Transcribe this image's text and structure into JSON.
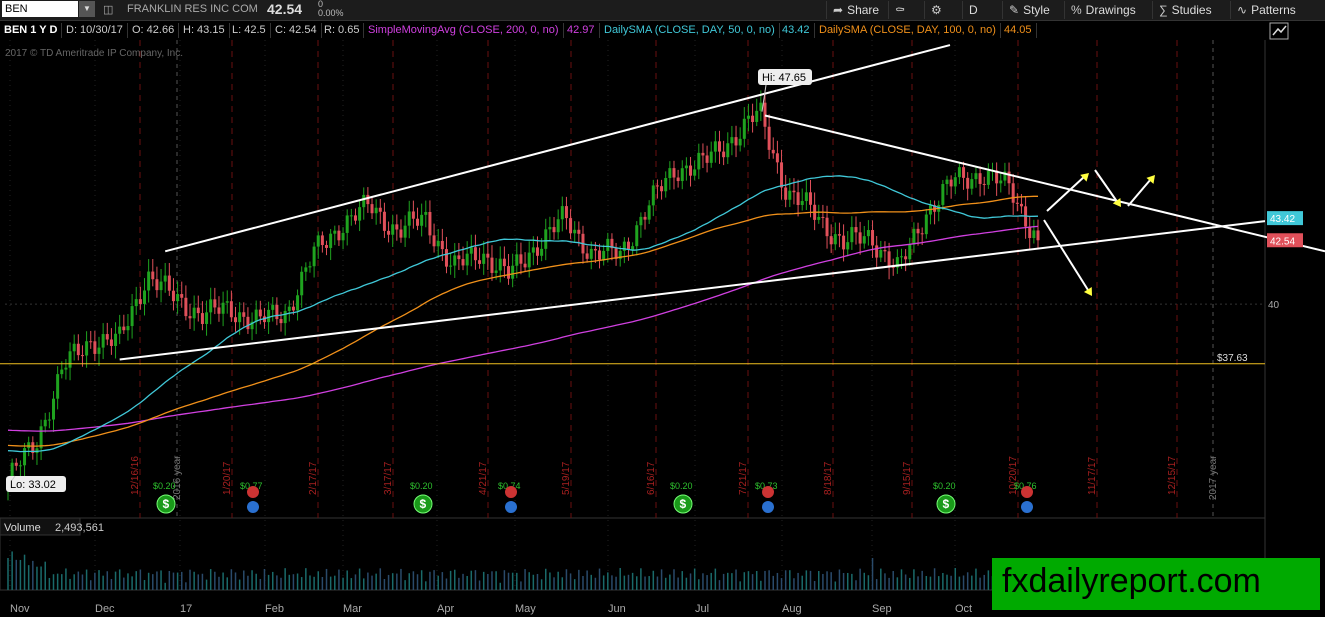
{
  "toolbar": {
    "symbol": "BEN",
    "company": "FRANKLIN RES INC COM",
    "last": "42.54",
    "change": "0",
    "change_pct": "0.00%",
    "share_label": "Share",
    "timeframe": "D",
    "style_label": "Style",
    "drawings_label": "Drawings",
    "studies_label": "Studies",
    "patterns_label": "Patterns"
  },
  "info": {
    "title": "BEN 1 Y D",
    "date": "D: 10/30/17",
    "open": "O: 42.66",
    "high": "H: 43.15",
    "low": "L: 42.5",
    "close": "C: 42.54",
    "range": "R: 0.65",
    "sma200_label": "SimpleMovingAvg (CLOSE, 200, 0, no)",
    "sma200_val": "42.97",
    "sma50_label": "DailySMA (CLOSE, DAY, 50, 0, no)",
    "sma50_val": "43.42",
    "sma100_label": "DailySMA (CLOSE, DAY, 100, 0, no)",
    "sma100_val": "44.05",
    "copyright": "2017 © TD Ameritrade IP Company, Inc."
  },
  "volume": {
    "label": "Volume",
    "value": "2,493,561"
  },
  "watermark": "fxdailyreport.com",
  "colors": {
    "up": "#1fa31f",
    "down": "#e0505a",
    "sma200": "#d040e0",
    "sma50": "#40c8d8",
    "sma100": "#f0901a",
    "support": "#f0c020",
    "trend": "#ffffff",
    "arrow": "#ffff40"
  },
  "chart_data": {
    "type": "candlestick",
    "symbol": "BEN",
    "ylim": [
      31.5,
      50.5
    ],
    "y_ticks": [
      40
    ],
    "x_labels": [
      "Nov",
      "Dec",
      "17",
      "Feb",
      "Mar",
      "Apr",
      "May",
      "Jun",
      "Jul",
      "Aug",
      "Sep",
      "Oct"
    ],
    "date_markers": [
      "12/16/16",
      "1/20/17",
      "2/17/17",
      "3/17/17",
      "4/21/17",
      "5/19/17",
      "6/16/17",
      "7/21/17",
      "8/18/17",
      "9/15/17",
      "10/20/17",
      "11/17/17",
      "12/15/17"
    ],
    "year_markers": [
      "2016 year",
      "2017 year"
    ],
    "price_labels": [
      {
        "label": "43.42",
        "value": 43.42,
        "color": "#40c8d8"
      },
      {
        "label": "42.54",
        "value": 42.54,
        "color": "#e0505a"
      },
      {
        "label": "$37.63",
        "value": 37.63,
        "color": "#f0c020"
      }
    ],
    "annotations": [
      {
        "text": "Hi: 47.65",
        "value": 47.65
      },
      {
        "text": "Lo: 33.02",
        "value": 33.02
      }
    ],
    "dividends": [
      {
        "label": "$0.20",
        "type": "dividend",
        "date": "Dec"
      },
      {
        "label": "$0.77",
        "type": "earnings",
        "date": "Jan"
      },
      {
        "label": "$0.20",
        "type": "dividend",
        "date": "Mar"
      },
      {
        "label": "$0.74",
        "type": "earnings",
        "date": "Apr"
      },
      {
        "label": "$0.20",
        "type": "dividend",
        "date": "Jun"
      },
      {
        "label": "$0.73",
        "type": "earnings",
        "date": "Jul"
      },
      {
        "label": "$0.20",
        "type": "dividend",
        "date": "Sep"
      },
      {
        "label": "$0.76",
        "type": "earnings",
        "date": "Oct"
      }
    ],
    "close_path": [
      [
        "Nov",
        33.0
      ],
      [
        "Nov",
        34.5
      ],
      [
        "Nov",
        37.5
      ],
      [
        "Nov",
        38.6
      ],
      [
        "Dec",
        38.5
      ],
      [
        "Dec",
        41.2
      ],
      [
        "Dec",
        40.2
      ],
      [
        "17",
        39.6
      ],
      [
        "17",
        39.8
      ],
      [
        "17",
        39.3
      ],
      [
        "Feb",
        39.7
      ],
      [
        "Feb",
        42.0
      ],
      [
        "Feb",
        43.2
      ],
      [
        "Mar",
        43.9
      ],
      [
        "Mar",
        42.9
      ],
      [
        "Mar",
        43.4
      ],
      [
        "Apr",
        41.4
      ],
      [
        "Apr",
        42.1
      ],
      [
        "Apr",
        41.1
      ],
      [
        "May",
        42.4
      ],
      [
        "May",
        43.4
      ],
      [
        "May",
        42.0
      ],
      [
        "Jun",
        42.0
      ],
      [
        "Jun",
        43.9
      ],
      [
        "Jun",
        45.4
      ],
      [
        "Jul",
        45.6
      ],
      [
        "Jul",
        46.6
      ],
      [
        "Jul",
        47.6
      ],
      [
        "Aug",
        44.4
      ],
      [
        "Aug",
        43.6
      ],
      [
        "Aug",
        42.4
      ],
      [
        "Sep",
        42.7
      ],
      [
        "Sep",
        41.3
      ],
      [
        "Sep",
        43.7
      ],
      [
        "Oct",
        44.9
      ],
      [
        "Oct",
        45.2
      ],
      [
        "Oct",
        44.6
      ],
      [
        "Oct",
        42.54
      ]
    ],
    "volume_peak": "2,493,561"
  }
}
